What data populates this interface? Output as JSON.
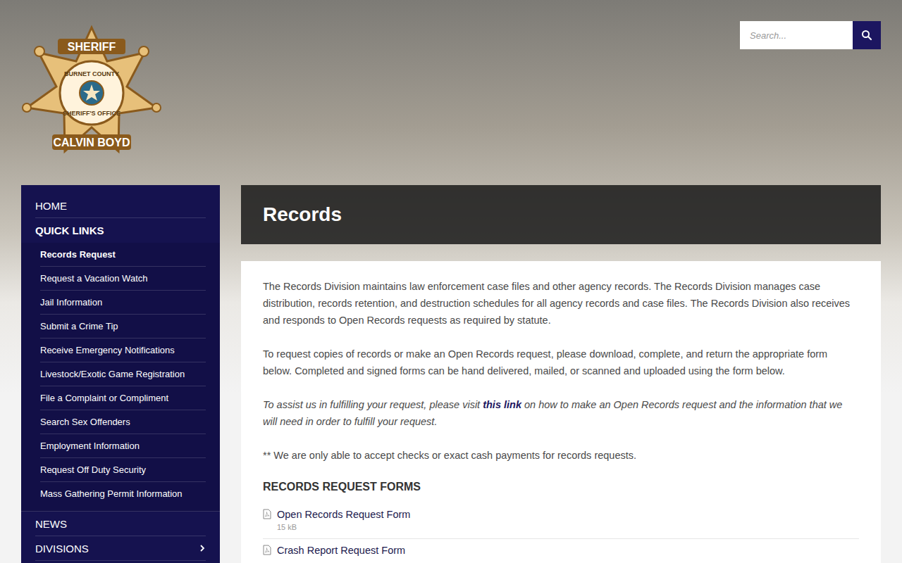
{
  "logo": {
    "top": "SHERIFF",
    "ring_top": "BURNET COUNTY",
    "ring_bottom": "SHERIFF'S OFFICE",
    "bottom": "CALVIN BOYD"
  },
  "search": {
    "placeholder": "Search..."
  },
  "sidebar": {
    "items": [
      {
        "label": "HOME",
        "expanded": false,
        "has_submenu": false,
        "children": []
      },
      {
        "label": "QUICK LINKS",
        "expanded": true,
        "has_submenu": false,
        "children": [
          {
            "label": "Records Request",
            "selected": true
          },
          {
            "label": "Request a Vacation Watch",
            "selected": false
          },
          {
            "label": "Jail Information",
            "selected": false
          },
          {
            "label": "Submit a Crime Tip",
            "selected": false
          },
          {
            "label": "Receive Emergency Notifications",
            "selected": false
          },
          {
            "label": "Livestock/Exotic Game Registration",
            "selected": false
          },
          {
            "label": "File a Complaint or Compliment",
            "selected": false
          },
          {
            "label": "Search Sex Offenders",
            "selected": false
          },
          {
            "label": "Employment Information",
            "selected": false
          },
          {
            "label": "Request Off Duty Security",
            "selected": false
          },
          {
            "label": "Mass Gathering Permit Information",
            "selected": false
          }
        ]
      },
      {
        "label": "NEWS",
        "expanded": false,
        "has_submenu": false,
        "children": []
      },
      {
        "label": "DIVISIONS",
        "expanded": false,
        "has_submenu": true,
        "children": []
      }
    ]
  },
  "page": {
    "title": "Records",
    "paragraphs": [
      "The Records Division maintains law enforcement case files and other agency records. The Records Division manages case distribution, records retention, and destruction schedules for all agency records and case files. The Records Division also receives and responds to Open Records requests as required by statute.",
      "To request copies of records or make an Open Records request, please download, complete, and return the appropriate form below. Completed and signed forms can be hand delivered, mailed, or scanned and uploaded using the form below."
    ],
    "note": {
      "before": "To assist us in fulfilling your request, please visit ",
      "link": "this link",
      "after": " on how to make an Open Records request and the information that we will need in order to fulfill your request."
    },
    "payment": "** We are only able to accept checks or exact cash payments for records requests.",
    "forms_heading": "RECORDS REQUEST FORMS",
    "forms": [
      {
        "label": "Open Records Request Form",
        "size": "15 kB"
      },
      {
        "label": "Crash Report Request Form"
      }
    ]
  }
}
